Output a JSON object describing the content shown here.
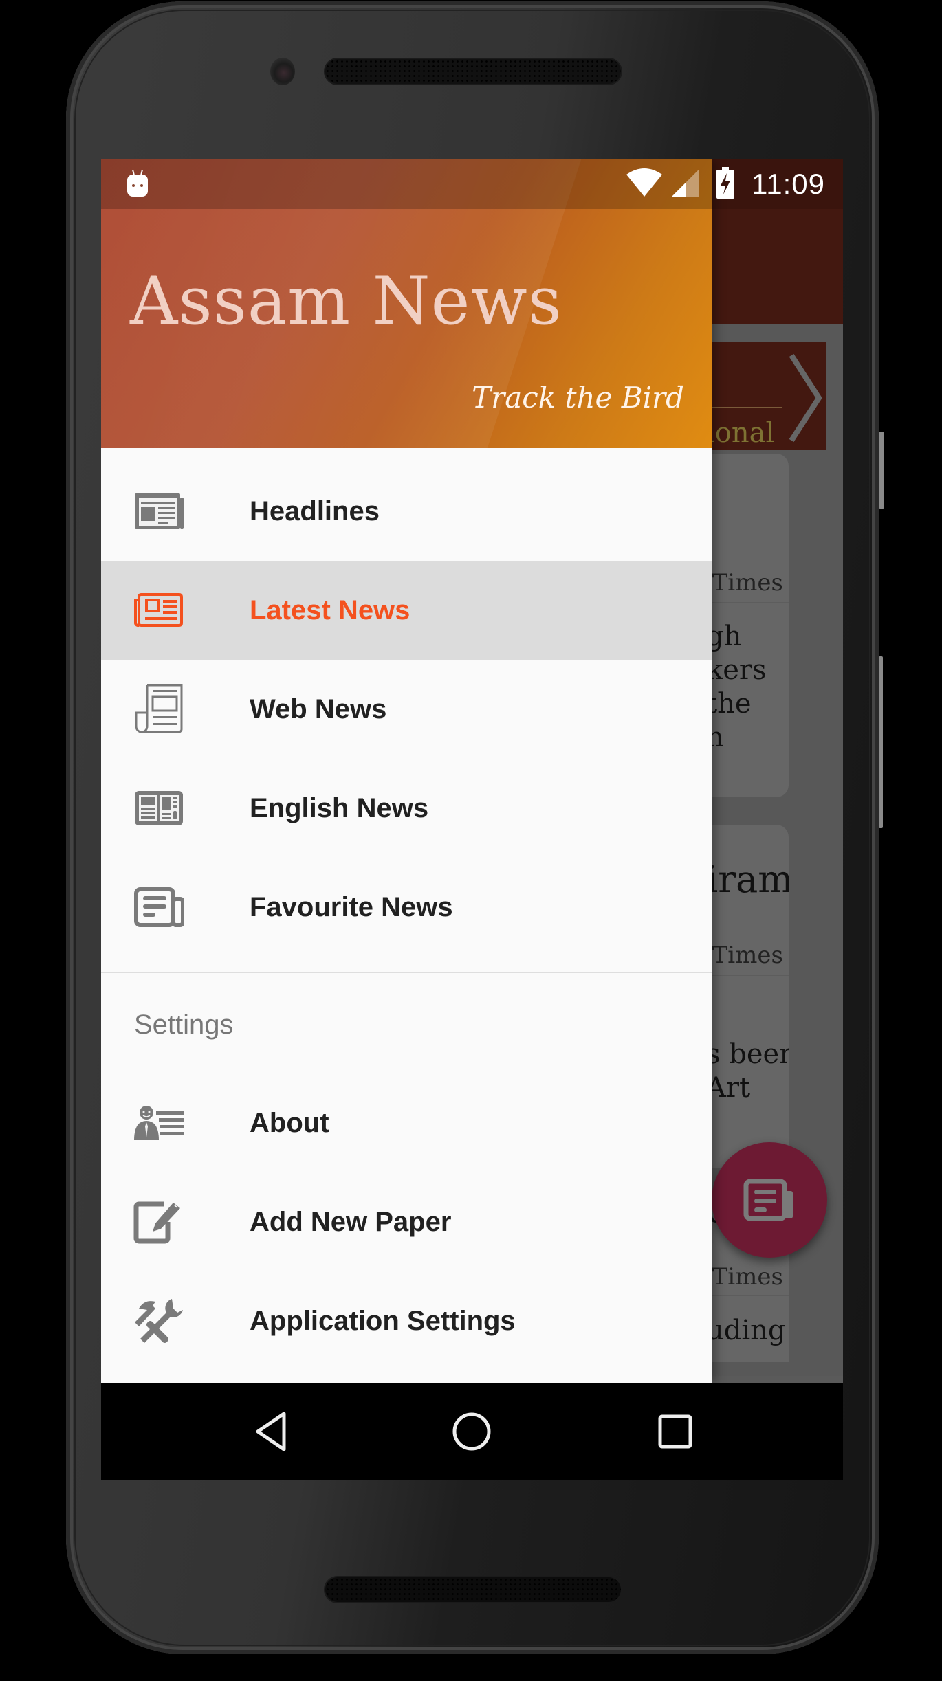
{
  "status_bar": {
    "time": "11:09",
    "icons": [
      "android-notification-icon",
      "wifi-icon",
      "cell-signal-icon",
      "battery-charging-icon"
    ]
  },
  "drawer": {
    "header": {
      "title": "Assam News",
      "tagline": "Track the Bird"
    },
    "primary_items": [
      {
        "label": "Headlines",
        "icon": "newspaper-icon",
        "active": false
      },
      {
        "label": "Latest News",
        "icon": "latest-news-icon",
        "active": true
      },
      {
        "label": "Web News",
        "icon": "web-news-icon",
        "active": false
      },
      {
        "label": "English News",
        "icon": "english-news-icon",
        "active": false
      },
      {
        "label": "Favourite News",
        "icon": "favourite-news-icon",
        "active": false
      }
    ],
    "settings_section": {
      "title": "Settings",
      "items": [
        {
          "label": "About",
          "icon": "about-person-icon"
        },
        {
          "label": "Add New Paper",
          "icon": "edit-icon"
        },
        {
          "label": "Application Settings",
          "icon": "tools-icon"
        }
      ]
    }
  },
  "background_app": {
    "tab_text_fragment": "ional",
    "cards": [
      {
        "source_fragment": "m Times",
        "body_fragment": "gh\nkers\nthe\nh"
      },
      {
        "title_fragment": "iram",
        "source_fragment": "m Times",
        "body_fragment": "s been\nArt"
      },
      {
        "title_fragment": "d",
        "source_fragment": "m Times",
        "body_fragment": "uding"
      }
    ]
  },
  "fab": {
    "icon": "newspaper-icon"
  },
  "nav_bar": {
    "buttons": [
      "back-icon",
      "home-icon",
      "recents-icon"
    ]
  },
  "colors": {
    "accent": "#f4511e",
    "header_start": "#ad4a33",
    "header_end": "#e08c12",
    "active_row_bg": "#dcdcdc",
    "fab": "#6d1a33",
    "icon_gray": "#7a7a7a"
  }
}
